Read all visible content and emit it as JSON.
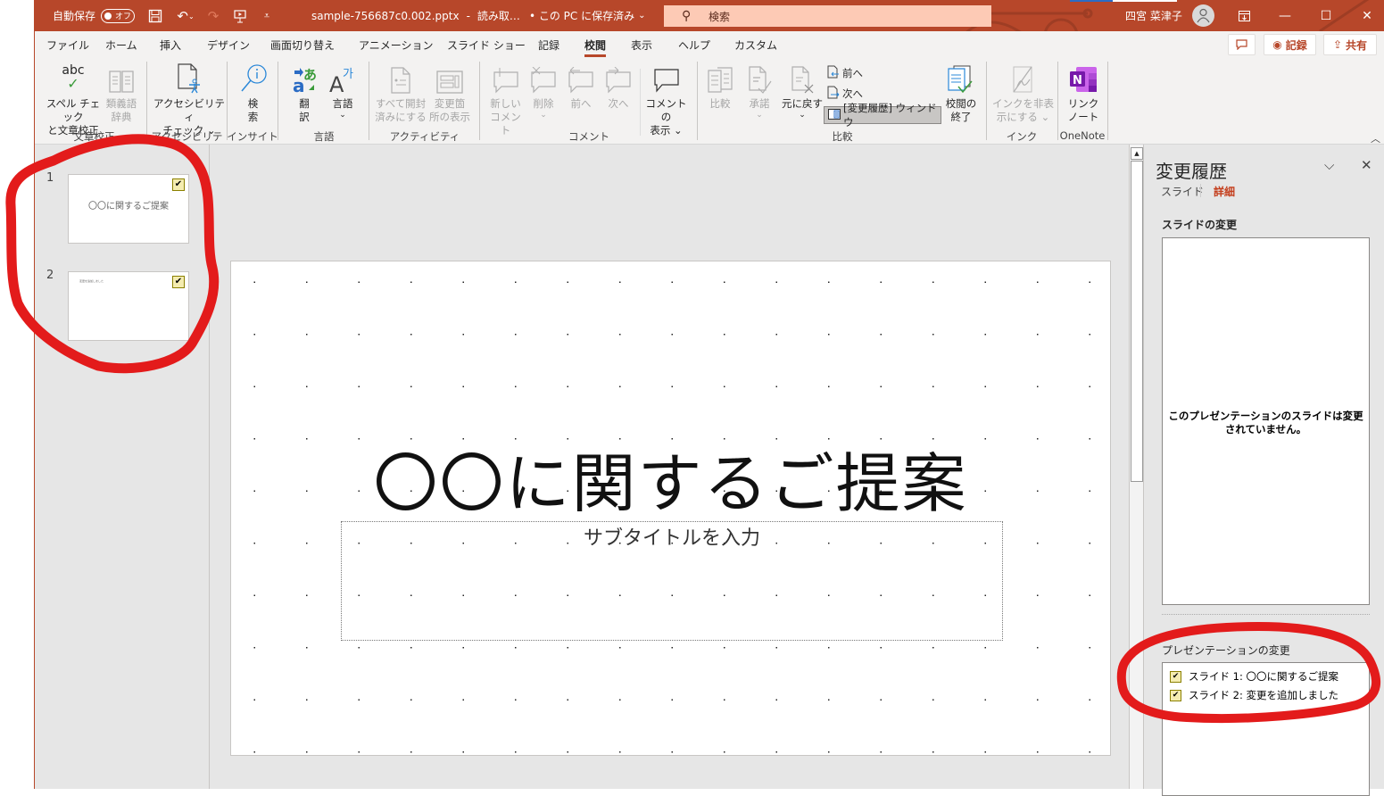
{
  "titlebar": {
    "autosave_label": "自動保存",
    "autosave_state": "オフ",
    "filename": "sample-756687c0.002.pptx",
    "separator": "-",
    "mode": "読み取…",
    "save_status": "• この PC に保存済み",
    "search_placeholder": "検索",
    "user_name": "四宮 菜津子",
    "accent": "#b7472a",
    "qat_icons": [
      "save-icon",
      "undo-icon",
      "redo-icon",
      "present-icon",
      "customize-icon"
    ]
  },
  "tabs": [
    {
      "label": "ファイル"
    },
    {
      "label": "ホーム"
    },
    {
      "label": "挿入"
    },
    {
      "label": "デザイン"
    },
    {
      "label": "画面切り替え"
    },
    {
      "label": "アニメーション"
    },
    {
      "label": "スライド ショー"
    },
    {
      "label": "記録"
    },
    {
      "label": "校閲",
      "active": true
    },
    {
      "label": "表示"
    },
    {
      "label": "ヘルプ"
    },
    {
      "label": "カスタム"
    }
  ],
  "top_buttons": {
    "comment": "",
    "record": "記録",
    "share": "共有"
  },
  "ribbon": {
    "groups": [
      {
        "label": "文章校正"
      },
      {
        "label": "アクセシビリティ"
      },
      {
        "label": "インサイト"
      },
      {
        "label": "言語"
      },
      {
        "label": "アクティビティ"
      },
      {
        "label": "コメント"
      },
      {
        "label": "比較"
      },
      {
        "label": "インク"
      },
      {
        "label": "OneNote"
      }
    ],
    "buttons": {
      "spell": {
        "line1": "スペル チェック",
        "line2": "と文章校正",
        "icon_text": "abc"
      },
      "thesaurus": {
        "line1": "類義語",
        "line2": "辞典"
      },
      "accessibility": {
        "line1": "アクセシビリティ",
        "line2": "チェック ⌄"
      },
      "search": {
        "line1": "検",
        "line2": "索"
      },
      "translate": {
        "line1": "翻",
        "line2": "訳"
      },
      "language": {
        "line1": "言語",
        "line2": "⌄"
      },
      "mark_read": {
        "line1": "すべて開封",
        "line2": "済みにする"
      },
      "show_changes": {
        "line1": "変更箇",
        "line2": "所の表示"
      },
      "new_comment": {
        "line1": "新しい",
        "line2": "コメント"
      },
      "delete": {
        "line1": "削除",
        "line2": "⌄"
      },
      "prev_comment": {
        "line1": "前へ"
      },
      "next_comment": {
        "line1": "次へ"
      },
      "show_comments": {
        "line1": "コメントの",
        "line2": "表示 ⌄"
      },
      "compare": {
        "line1": "比較"
      },
      "accept": {
        "line1": "承諾",
        "line2": "⌄"
      },
      "reject": {
        "line1": "元に戻す",
        "line2": "⌄"
      },
      "prev_change": "前へ",
      "next_change": "次へ",
      "history_window": "[変更履歴] ウィンドウ",
      "end_review": {
        "line1": "校閲の",
        "line2": "終了"
      },
      "hide_ink": {
        "line1": "インクを非表",
        "line2": "示にする ⌄"
      },
      "linked_notes": {
        "line1": "リンク",
        "line2": "ノート"
      }
    }
  },
  "thumbnails": [
    {
      "number": "1",
      "title": "〇〇に関するご提案",
      "has_changes": true
    },
    {
      "number": "2",
      "title": "変更を追加しました",
      "has_changes": true
    }
  ],
  "slide": {
    "title": "〇〇に関するご提案",
    "subtitle_placeholder": "サブタイトルを入力"
  },
  "revisions": {
    "title": "変更履歴",
    "tabs": [
      {
        "label": "スライド",
        "active": false
      },
      {
        "label": "詳細",
        "active": true
      }
    ],
    "slide_changes_label": "スライドの変更",
    "no_changes_message": "このプレゼンテーションのスライドは変更されていません。",
    "presentation_changes_label": "プレゼンテーションの変更",
    "presentation_changes": [
      {
        "text": "スライド 1: 〇〇に関するご提案"
      },
      {
        "text": "スライド 2: 変更を追加しました"
      }
    ]
  },
  "annotations": {
    "color": "#e31b1b"
  }
}
